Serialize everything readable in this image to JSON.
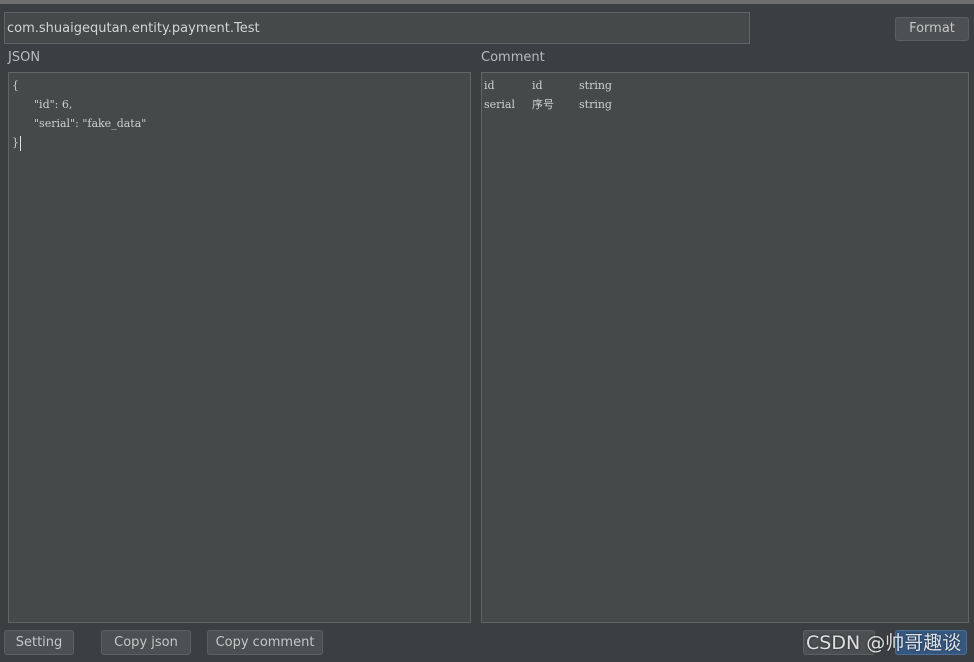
{
  "class_field": {
    "value": "com.shuaigequtan.entity.payment.Test"
  },
  "toolbar": {
    "format_label": "Format"
  },
  "json_panel": {
    "label": "JSON",
    "lines": [
      "{",
      "\"id\": 6,",
      "\"serial\": \"fake_data\"",
      "}"
    ]
  },
  "comment_panel": {
    "label": "Comment",
    "rows": [
      {
        "field": "id",
        "comment": "id",
        "type": "string"
      },
      {
        "field": "serial",
        "comment": "序号",
        "type": "string"
      }
    ]
  },
  "bottom_bar": {
    "setting_label": "Setting",
    "copy_json_label": "Copy  json",
    "copy_comment_label": "Copy comment"
  },
  "watermark": {
    "text": "CSDN @帅哥趣谈"
  },
  "colors": {
    "background": "#3c3f41",
    "panel": "#45494a",
    "border": "#646464",
    "primary_button": "#365880"
  }
}
